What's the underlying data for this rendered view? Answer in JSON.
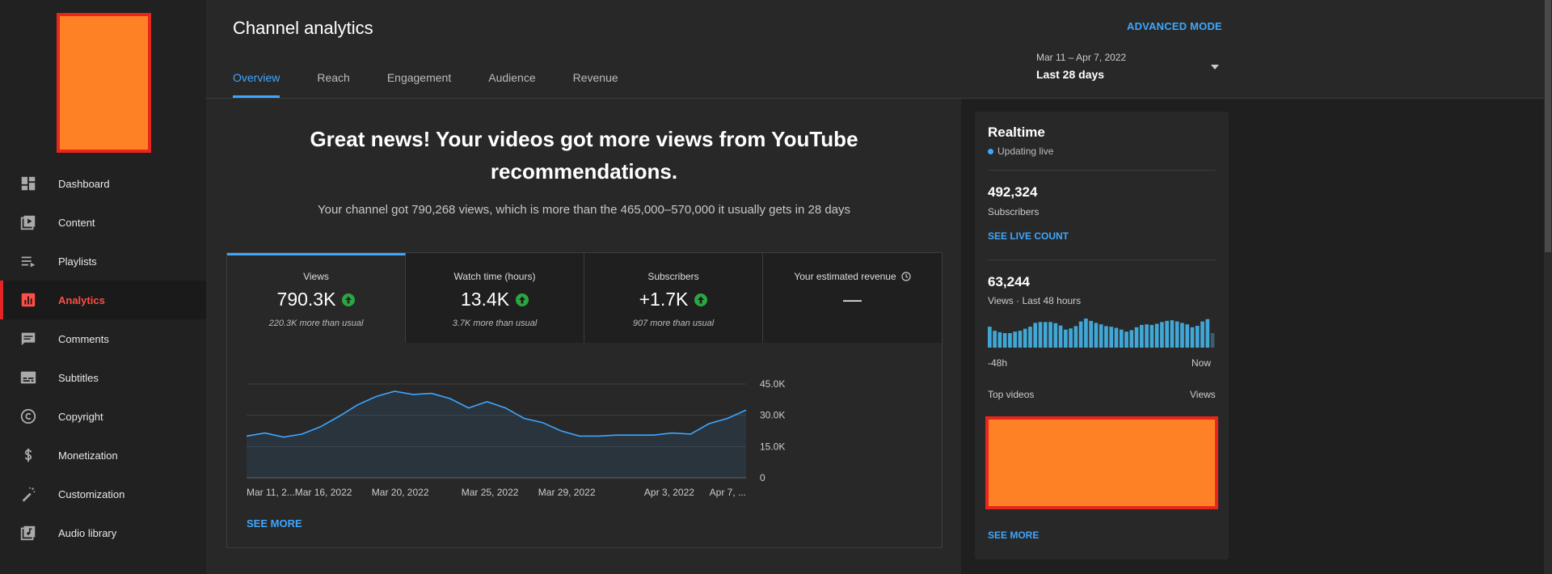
{
  "sidebar": {
    "items": [
      {
        "label": "Dashboard",
        "icon": "dashboard-icon"
      },
      {
        "label": "Content",
        "icon": "content-icon"
      },
      {
        "label": "Playlists",
        "icon": "playlists-icon"
      },
      {
        "label": "Analytics",
        "icon": "analytics-icon",
        "active": true
      },
      {
        "label": "Comments",
        "icon": "comments-icon"
      },
      {
        "label": "Subtitles",
        "icon": "subtitles-icon"
      },
      {
        "label": "Copyright",
        "icon": "copyright-icon"
      },
      {
        "label": "Monetization",
        "icon": "monetization-icon"
      },
      {
        "label": "Customization",
        "icon": "customization-icon"
      },
      {
        "label": "Audio library",
        "icon": "audio-library-icon"
      }
    ]
  },
  "header": {
    "title": "Channel analytics",
    "advanced_mode": "ADVANCED MODE",
    "tabs": [
      {
        "label": "Overview",
        "active": true
      },
      {
        "label": "Reach"
      },
      {
        "label": "Engagement"
      },
      {
        "label": "Audience"
      },
      {
        "label": "Revenue"
      }
    ],
    "date_range": "Mar 11 – Apr 7, 2022",
    "date_label": "Last 28 days"
  },
  "main": {
    "headline": "Great news! Your videos got more views from YouTube recommendations.",
    "subline": "Your channel got 790,268 views, which is more than the 465,000–570,000 it usually gets in 28 days",
    "metrics": [
      {
        "label": "Views",
        "value": "790.3K",
        "note": "220.3K more than usual",
        "trend": "up"
      },
      {
        "label": "Watch time (hours)",
        "value": "13.4K",
        "note": "3.7K more than usual",
        "trend": "up"
      },
      {
        "label": "Subscribers",
        "value": "+1.7K",
        "note": "907 more than usual",
        "trend": "up"
      },
      {
        "label": "Your estimated revenue",
        "value": "—",
        "note": ""
      }
    ],
    "see_more": "SEE MORE"
  },
  "chart_data": {
    "type": "area",
    "x_tick_labels": [
      "Mar 11, 2...",
      "Mar 16, 2022",
      "Mar 20, 2022",
      "Mar 25, 2022",
      "Mar 29, 2022",
      "Apr 3, 2022",
      "Apr 7, ..."
    ],
    "y_tick_labels": [
      "45.0K",
      "30.0K",
      "15.0K",
      "0"
    ],
    "ylim": [
      0,
      45000
    ],
    "values": [
      20000,
      21500,
      19500,
      21000,
      24500,
      29500,
      35000,
      39000,
      41500,
      40000,
      40500,
      38000,
      33500,
      36500,
      33500,
      28500,
      26500,
      22500,
      20000,
      20000,
      20500,
      20500,
      20500,
      21500,
      21000,
      26000,
      28500,
      32500
    ],
    "color": "#3ea6ff",
    "grid": true
  },
  "realtime": {
    "title": "Realtime",
    "live": "Updating live",
    "subscribers": "492,324",
    "subscribers_label": "Subscribers",
    "see_live_count": "SEE LIVE COUNT",
    "views": "63,244",
    "views_label": "Views · Last 48 hours",
    "axis_left": "-48h",
    "axis_right": "Now",
    "bars": [
      0.72,
      0.58,
      0.53,
      0.5,
      0.5,
      0.55,
      0.58,
      0.65,
      0.72,
      0.85,
      0.88,
      0.88,
      0.88,
      0.84,
      0.76,
      0.62,
      0.66,
      0.74,
      0.9,
      1.0,
      0.92,
      0.85,
      0.8,
      0.74,
      0.72,
      0.68,
      0.62,
      0.55,
      0.6,
      0.7,
      0.78,
      0.8,
      0.78,
      0.82,
      0.88,
      0.92,
      0.94,
      0.9,
      0.85,
      0.8,
      0.7,
      0.75,
      0.9,
      0.98,
      0.5
    ],
    "top_videos": "Top videos",
    "views_col": "Views",
    "see_more": "SEE MORE"
  }
}
